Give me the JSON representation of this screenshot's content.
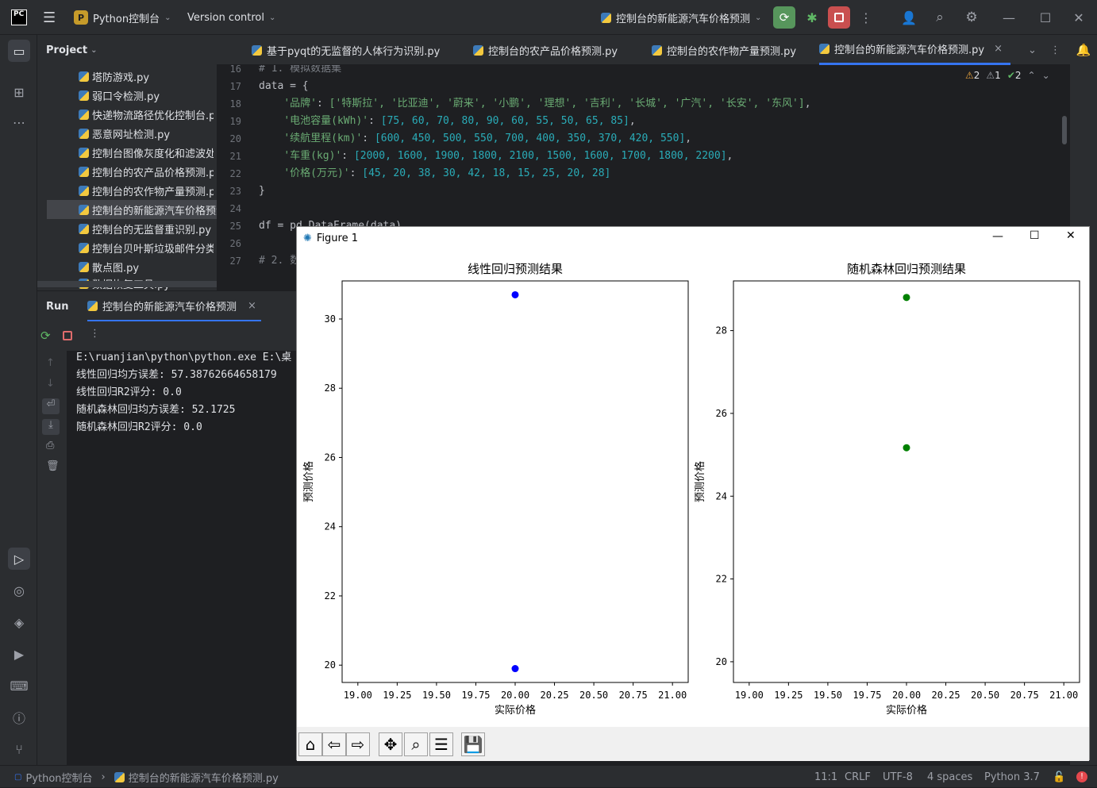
{
  "titlebar": {
    "project_label": "Python控制台",
    "project_badge": "P",
    "vcs_label": "Version control",
    "run_config": "控制台的新能源汽车价格预测",
    "logo": "PC"
  },
  "project_panel": {
    "title": "Project",
    "items": [
      "塔防游戏.py",
      "弱口令检测.py",
      "快递物流路径优化控制台.py",
      "恶意网址检测.py",
      "控制台图像灰度化和滤波处理.py",
      "控制台的农产品价格预测.py",
      "控制台的农作物产量预测.py",
      "控制台的新能源汽车价格预测.py",
      "控制台的无监督重识别.py",
      "控制台贝叶斯垃圾邮件分类.py",
      "散点图.py",
      "数据恢复工具.py"
    ]
  },
  "editor": {
    "tabs": [
      "基于pyqt的无监督的人体行为识别.py",
      "控制台的农产品价格预测.py",
      "控制台的农作物产量预测.py",
      "控制台的新能源汽车价格预测.py"
    ],
    "inspections": {
      "warnings": "2",
      "weak": "1",
      "ok": "2"
    },
    "line_numbers": [
      "16",
      "17",
      "18",
      "19",
      "20",
      "21",
      "22",
      "23",
      "24",
      "25",
      "26",
      "27"
    ],
    "lines": {
      "l16": "# 1. 模拟数据集",
      "l17": "data = {",
      "l18_key": "'品牌'",
      "l18_val": "['特斯拉', '比亚迪', '蔚来', '小鹏', '理想', '吉利', '长城', '广汽', '长安', '东风']",
      "l19_key": "'电池容量(kWh)'",
      "l19_val": "[75, 60, 70, 80, 90, 60, 55, 50, 65, 85]",
      "l20_key": "'续航里程(km)'",
      "l20_val": "[600, 450, 500, 550, 700, 400, 350, 370, 420, 550]",
      "l21_key": "'车重(kg)'",
      "l21_val": "[2000, 1600, 1900, 1800, 2100, 1500, 1600, 1700, 1800, 2200]",
      "l22_key": "'价格(万元)'",
      "l22_val": "[45, 20, 38, 30, 42, 18, 15, 25, 20, 28]",
      "l23": "}",
      "l25": "df = pd.DataFrame(data)",
      "l27": "# 2. 数"
    }
  },
  "run_panel": {
    "title": "Run",
    "tab": "控制台的新能源汽车价格预测",
    "output": [
      "E:\\ruanjian\\python\\python.exe E:\\桌",
      "线性回归均方误差: 57.38762664658179",
      "线性回归R2评分: 0.0",
      "随机森林回归均方误差: 52.1725",
      "随机森林回归R2评分: 0.0"
    ]
  },
  "figure": {
    "window_title": "Figure 1"
  },
  "chart_data": [
    {
      "type": "scatter",
      "title": "线性回归预测结果",
      "xlabel": "实际价格",
      "ylabel": "预测价格",
      "xlim": [
        18.9,
        21.1
      ],
      "ylim": [
        19.5,
        31.1
      ],
      "xticks": [
        "19.00",
        "19.25",
        "19.50",
        "19.75",
        "20.00",
        "20.25",
        "20.50",
        "20.75",
        "21.00"
      ],
      "xtick_values": [
        19.0,
        19.25,
        19.5,
        19.75,
        20.0,
        20.25,
        20.5,
        20.75,
        21.0
      ],
      "yticks": [
        "20",
        "22",
        "24",
        "26",
        "28",
        "30"
      ],
      "ytick_values": [
        20,
        22,
        24,
        26,
        28,
        30
      ],
      "color": "#0000ff",
      "points": [
        {
          "x": 20.0,
          "y": 30.7
        },
        {
          "x": 20.0,
          "y": 19.9
        }
      ]
    },
    {
      "type": "scatter",
      "title": "随机森林回归预测结果",
      "xlabel": "实际价格",
      "ylabel": "预测价格",
      "xlim": [
        18.9,
        21.1
      ],
      "ylim": [
        19.5,
        29.2
      ],
      "xticks": [
        "19.00",
        "19.25",
        "19.50",
        "19.75",
        "20.00",
        "20.25",
        "20.50",
        "20.75",
        "21.00"
      ],
      "xtick_values": [
        19.0,
        19.25,
        19.5,
        19.75,
        20.0,
        20.25,
        20.5,
        20.75,
        21.0
      ],
      "yticks": [
        "20",
        "22",
        "24",
        "26",
        "28"
      ],
      "ytick_values": [
        20,
        22,
        24,
        26,
        28
      ],
      "color": "#008000",
      "points": [
        {
          "x": 20.0,
          "y": 28.8
        },
        {
          "x": 20.0,
          "y": 25.17
        }
      ]
    }
  ],
  "statusbar": {
    "breadcrumb_project": "Python控制台",
    "breadcrumb_file": "控制台的新能源汽车价格预测.py",
    "position": "11:1",
    "line_sep": "CRLF",
    "encoding": "UTF-8",
    "indent": "4 spaces",
    "interpreter": "Python 3.7"
  }
}
